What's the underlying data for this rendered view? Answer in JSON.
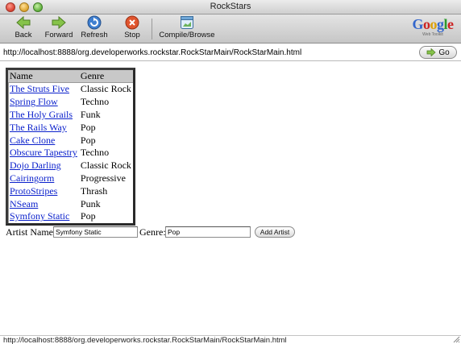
{
  "window": {
    "title": "RockStars"
  },
  "toolbar": {
    "back_label": "Back",
    "forward_label": "Forward",
    "refresh_label": "Refresh",
    "stop_label": "Stop",
    "compile_label": "Compile/Browse"
  },
  "logo": {
    "word": "Google",
    "sub": "Web Toolkit"
  },
  "address": {
    "url": "http://localhost:8888/org.developerworks.rockstar.RockStarMain/RockStarMain.html",
    "go_label": "Go"
  },
  "table": {
    "columns": [
      "Name",
      "Genre"
    ],
    "rows": [
      {
        "name": "The Struts Five",
        "genre": "Classic Rock"
      },
      {
        "name": "Spring Flow",
        "genre": "Techno"
      },
      {
        "name": "The Holy Grails",
        "genre": "Funk"
      },
      {
        "name": "The Rails Way",
        "genre": "Pop"
      },
      {
        "name": "Cake Clone",
        "genre": "Pop"
      },
      {
        "name": "Obscure Tapestry",
        "genre": "Techno"
      },
      {
        "name": "Dojo Darling",
        "genre": "Classic Rock"
      },
      {
        "name": "Cairingorm",
        "genre": "Progressive"
      },
      {
        "name": "ProtoStripes",
        "genre": "Thrash"
      },
      {
        "name": "NSeam",
        "genre": "Punk"
      },
      {
        "name": "Symfony Static",
        "genre": "Pop"
      }
    ]
  },
  "form": {
    "artist_label": "Artist Name:",
    "artist_value": "Symfony Static",
    "genre_label": "Genre:",
    "genre_value": "Pop",
    "add_label": "Add Artist"
  },
  "status": {
    "text": "http://localhost:8888/org.developerworks.rockstar.RockStarMain/RockStarMain.html"
  },
  "colors": {
    "link": "#0b21cc",
    "header_bg": "#c8c8c8"
  }
}
